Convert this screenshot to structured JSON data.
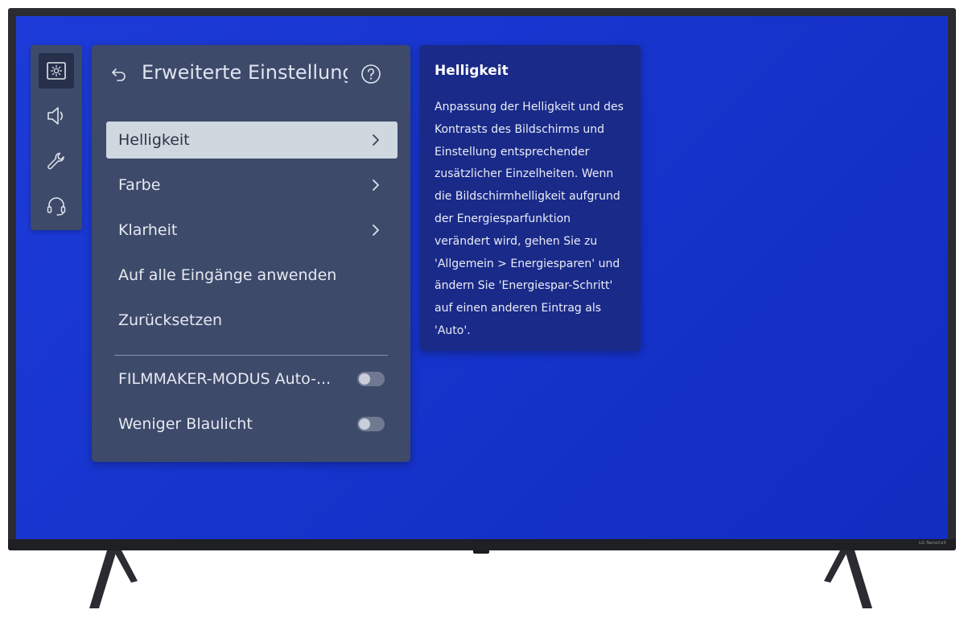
{
  "device": {
    "brand_mark": "LG NanoCell"
  },
  "icon_rail": {
    "items": [
      {
        "icon": "picture-settings-icon",
        "active": true
      },
      {
        "icon": "speaker-icon",
        "active": false
      },
      {
        "icon": "wrench-icon",
        "active": false
      },
      {
        "icon": "headset-icon",
        "active": false
      }
    ]
  },
  "menu": {
    "title": "Erweiterte Einstellung",
    "items": [
      {
        "label": "Helligkeit",
        "selected": true,
        "chevron": true
      },
      {
        "label": "Farbe",
        "chevron": true
      },
      {
        "label": "Klarheit",
        "chevron": true
      },
      {
        "label": "Auf alle Eingänge anwenden"
      },
      {
        "label": "Zurücksetzen"
      }
    ],
    "toggles": [
      {
        "label": "FILMMAKER-MODUS Auto-...",
        "state": "off"
      },
      {
        "label": "Weniger Blaulicht",
        "state": "off"
      }
    ]
  },
  "info": {
    "title": "Helligkeit",
    "lines": [
      "Anpassung der Helligkeit und des",
      "Kontrasts des Bildschirms und",
      "Einstellung entsprechender",
      "zusätzlicher Einzelheiten. Wenn",
      "die Bildschirmhelligkeit aufgrund",
      "der Energiesparfunktion",
      "verändert wird, gehen Sie zu",
      "'Allgemein > Energiesparen' und",
      "ändern Sie 'Energiespar-Schritt'",
      "auf einen anderen Eintrag als",
      "'Auto'."
    ]
  },
  "colors": {
    "screen_blue": "#1532c9",
    "panel_slate": "#3d4a6a",
    "info_navy": "#1a2a88",
    "selected_item": "#cfd7df"
  }
}
